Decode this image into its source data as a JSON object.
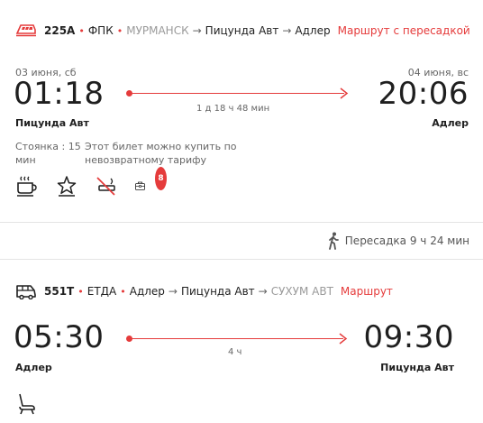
{
  "segment1": {
    "train_number": "225А",
    "carrier": "ФПК",
    "route_start": "МУРМАНСК",
    "route_mid": "Пицунда Авт",
    "route_end": "Адлер",
    "route_type": "Маршрут с пересадкой",
    "depart_date": "03 июня, сб",
    "depart_time": "01:18",
    "depart_station": "Пицунда Авт",
    "arrive_date": "04 июня, вс",
    "arrive_time": "20:06",
    "arrive_station": "Адлер",
    "duration": "1 д 18 ч 48 мин",
    "stop_label": "Стоянка : 15",
    "stop_unit": "мин",
    "ticket_note_line1": "Этот билет можно купить по",
    "ticket_note_line2": "невозвратному тарифу",
    "amenities": [
      "coffee-icon",
      "star-icon",
      "no-smoking-icon",
      "luggage-icon"
    ],
    "luggage_badge": "8"
  },
  "transfer": {
    "text": "Пересадка 9 ч 24 мин",
    "icon": "walking-person-icon"
  },
  "segment2": {
    "train_number": "551Т",
    "carrier": "ЕТДА",
    "route_start": "Адлер",
    "route_mid": "Пицунда Авт",
    "route_end": "СУХУМ АВТ",
    "route_type": "Маршрут",
    "depart_time": "05:30",
    "depart_station": "Адлер",
    "arrive_time": "09:30",
    "arrive_station": "Пицунда Авт",
    "duration": "4 ч",
    "amenities": [
      "seat-icon"
    ]
  },
  "colors": {
    "accent": "#e53b3b",
    "text": "#1f1f1f",
    "muted": "#666666",
    "divider": "#e4e4e4"
  }
}
